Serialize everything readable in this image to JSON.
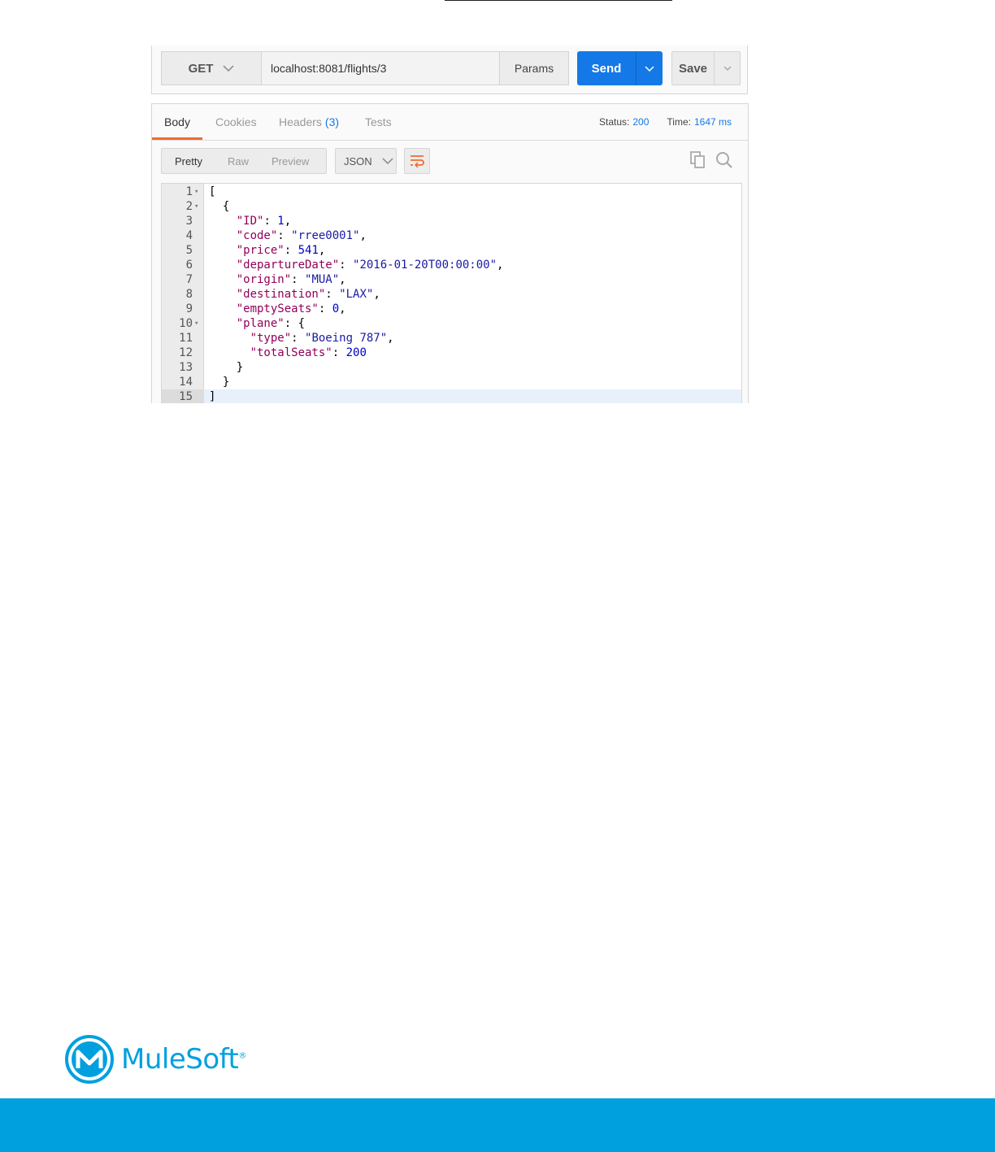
{
  "request": {
    "method": "GET",
    "url": "localhost:8081/flights/3",
    "params_label": "Params",
    "send_label": "Send",
    "save_label": "Save"
  },
  "response": {
    "tabs": [
      {
        "label": "Body"
      },
      {
        "label": "Cookies"
      },
      {
        "label": "Headers",
        "count": "(3)"
      },
      {
        "label": "Tests"
      }
    ],
    "status_label": "Status:",
    "status_value": "200",
    "time_label": "Time:",
    "time_value": "1647 ms",
    "view_options": [
      "Pretty",
      "Raw",
      "Preview"
    ],
    "format": "JSON",
    "accent_color": "#ef6c32",
    "code_lines": [
      {
        "n": "1",
        "fold": "▾",
        "text": "["
      },
      {
        "n": "2",
        "fold": "▾",
        "text": "  {"
      },
      {
        "n": "3",
        "text": "    \"ID\": 1,"
      },
      {
        "n": "4",
        "text": "    \"code\": \"rree0001\","
      },
      {
        "n": "5",
        "text": "    \"price\": 541,"
      },
      {
        "n": "6",
        "text": "    \"departureDate\": \"2016-01-20T00:00:00\","
      },
      {
        "n": "7",
        "text": "    \"origin\": \"MUA\","
      },
      {
        "n": "8",
        "text": "    \"destination\": \"LAX\","
      },
      {
        "n": "9",
        "text": "    \"emptySeats\": 0,"
      },
      {
        "n": "10",
        "fold": "▾",
        "text": "    \"plane\": {"
      },
      {
        "n": "11",
        "text": "      \"type\": \"Boeing 787\","
      },
      {
        "n": "12",
        "text": "      \"totalSeats\": 200"
      },
      {
        "n": "13",
        "text": "    }"
      },
      {
        "n": "14",
        "text": "  }"
      },
      {
        "n": "15",
        "text": "]",
        "current": true
      }
    ]
  },
  "footer": {
    "logo_text": "MuleSoft",
    "brand_color": "#00a0df"
  }
}
